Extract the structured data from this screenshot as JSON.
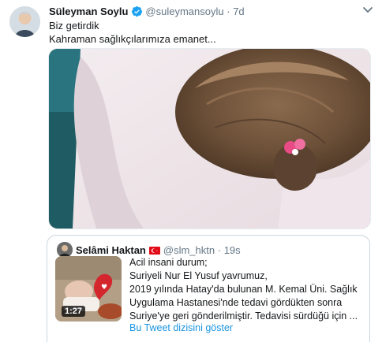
{
  "tweet": {
    "author_name": "Süleyman Soylu",
    "handle": "@suleymansoylu",
    "separator": "·",
    "time": "7d",
    "line1": "Biz getirdik",
    "line2": "Kahraman sağlıkçılarımıza emanet...",
    "verified_icon": "verified-badge-icon",
    "colors": {
      "verified": "#1da1f2",
      "muted": "#657786"
    }
  },
  "quoted": {
    "author_name": "Selâmi Haktan",
    "handle": "@slm_hktn",
    "separator": "·",
    "time": "19s",
    "video_duration": "1:27",
    "lines": [
      "Acil insani durum;",
      "Suriyeli Nur El Yusuf yavrumuz,",
      "2019 yılında Hatay'da bulunan M. Kemal Üni. Sağlık",
      "Uygulama Hastanesi'nde tedavi gördükten sonra",
      "Suriye'ye geri gönderilmiştir. Tedavisi sürdüğü için ..."
    ],
    "thread_link": "Bu Tweet dizisini göster",
    "colors": {
      "link": "#1b95e0",
      "flag": "#e30a17"
    }
  }
}
